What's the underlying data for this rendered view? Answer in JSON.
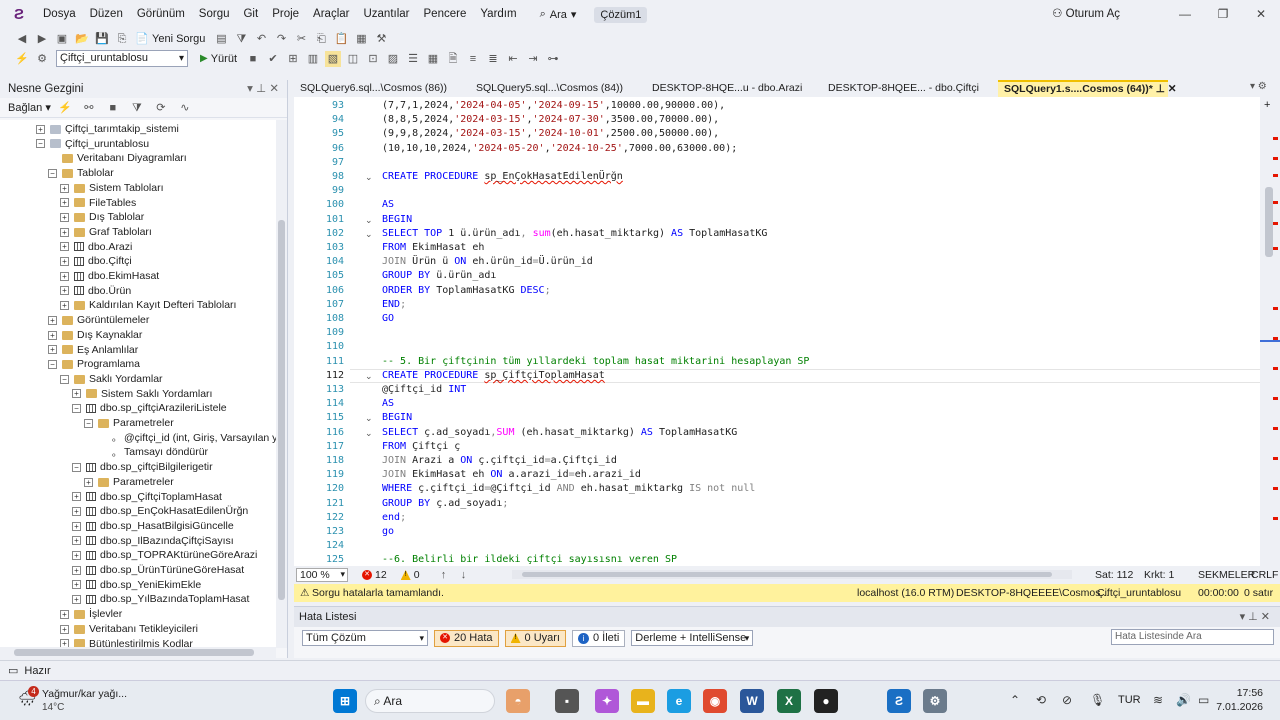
{
  "menu": {
    "items": [
      "Dosya",
      "Düzen",
      "Görünüm",
      "Sorgu",
      "Git",
      "Proje",
      "Araçlar",
      "Uzantılar",
      "Pencere",
      "Yardım"
    ],
    "search": "Ara",
    "solution": "Çözüm1",
    "login": "Oturum Aç"
  },
  "toolbar": {
    "new_query": "Yeni Sorgu",
    "database": "Çiftçi_uruntablosu",
    "execute": "Yürüt"
  },
  "explorer": {
    "title": "Nesne Gezgini",
    "connect": "Bağlan",
    "nodes": [
      {
        "t": "Çiftçi_tarımtakip_sistemi",
        "l": 3,
        "e": "+",
        "i": "db"
      },
      {
        "t": "Çiftçi_uruntablosu",
        "l": 3,
        "e": "-",
        "i": "db"
      },
      {
        "t": "Veritabanı Diyagramları",
        "l": 4,
        "e": "",
        "i": "fold"
      },
      {
        "t": "Tablolar",
        "l": 4,
        "e": "-",
        "i": "fold"
      },
      {
        "t": "Sistem Tabloları",
        "l": 5,
        "e": "+",
        "i": "fold"
      },
      {
        "t": "FileTables",
        "l": 5,
        "e": "+",
        "i": "fold"
      },
      {
        "t": "Dış Tablolar",
        "l": 5,
        "e": "+",
        "i": "fold"
      },
      {
        "t": "Graf Tabloları",
        "l": 5,
        "e": "+",
        "i": "fold"
      },
      {
        "t": "dbo.Arazi",
        "l": 5,
        "e": "+",
        "i": "tbl"
      },
      {
        "t": "dbo.Çiftçi",
        "l": 5,
        "e": "+",
        "i": "tbl"
      },
      {
        "t": "dbo.EkimHasat",
        "l": 5,
        "e": "+",
        "i": "tbl"
      },
      {
        "t": "dbo.Ürün",
        "l": 5,
        "e": "+",
        "i": "tbl"
      },
      {
        "t": "Kaldırılan Kayıt Defteri Tabloları",
        "l": 5,
        "e": "+",
        "i": "fold"
      },
      {
        "t": "Görüntülemeler",
        "l": 4,
        "e": "+",
        "i": "fold"
      },
      {
        "t": "Dış Kaynaklar",
        "l": 4,
        "e": "+",
        "i": "fold"
      },
      {
        "t": "Eş Anlamlılar",
        "l": 4,
        "e": "+",
        "i": "fold"
      },
      {
        "t": "Programlama",
        "l": 4,
        "e": "-",
        "i": "fold"
      },
      {
        "t": "Saklı Yordamlar",
        "l": 5,
        "e": "-",
        "i": "fold"
      },
      {
        "t": "Sistem Saklı Yordamları",
        "l": 6,
        "e": "+",
        "i": "fold"
      },
      {
        "t": "dbo.sp_çiftçiArazileriListele",
        "l": 6,
        "e": "-",
        "i": "tbl"
      },
      {
        "t": "Parametreler",
        "l": 7,
        "e": "-",
        "i": "fold"
      },
      {
        "t": "@çiftçi_id (int, Giriş, Varsayılan yok",
        "l": 8,
        "e": "",
        "i": "par"
      },
      {
        "t": "Tamsayı döndürür",
        "l": 8,
        "e": "",
        "i": "par"
      },
      {
        "t": "dbo.sp_çiftçiBilgilerigetir",
        "l": 6,
        "e": "-",
        "i": "tbl"
      },
      {
        "t": "Parametreler",
        "l": 7,
        "e": "+",
        "i": "fold"
      },
      {
        "t": "dbo.sp_ÇiftçiToplamHasat",
        "l": 6,
        "e": "+",
        "i": "tbl"
      },
      {
        "t": "dbo.sp_EnÇokHasatEdilenÜrğn",
        "l": 6,
        "e": "+",
        "i": "tbl"
      },
      {
        "t": "dbo.sp_HasatBilgisiGüncelle",
        "l": 6,
        "e": "+",
        "i": "tbl"
      },
      {
        "t": "dbo.sp_IlBazındaÇiftçiSayısı",
        "l": 6,
        "e": "+",
        "i": "tbl"
      },
      {
        "t": "dbo.sp_TOPRAKtürüneGöreArazi",
        "l": 6,
        "e": "+",
        "i": "tbl"
      },
      {
        "t": "dbo.sp_ÜrünTürüneGöreHasat",
        "l": 6,
        "e": "+",
        "i": "tbl"
      },
      {
        "t": "dbo.sp_YeniEkimEkle",
        "l": 6,
        "e": "+",
        "i": "tbl"
      },
      {
        "t": "dbo.sp_YılBazındaToplamHasat",
        "l": 6,
        "e": "+",
        "i": "tbl"
      },
      {
        "t": "İşlevler",
        "l": 5,
        "e": "+",
        "i": "fold"
      },
      {
        "t": "Veritabanı Tetikleyicileri",
        "l": 5,
        "e": "+",
        "i": "fold"
      },
      {
        "t": "Bütünleştirilmiş Kodlar",
        "l": 5,
        "e": "+",
        "i": "fold"
      }
    ]
  },
  "tabs": [
    {
      "label": "SQLQuery6.sql...\\Cosmos (86))",
      "active": false
    },
    {
      "label": "SQLQuery5.sql...\\Cosmos (84))",
      "active": false
    },
    {
      "label": "DESKTOP-8HQE...u - dbo.Arazi",
      "active": false
    },
    {
      "label": "DESKTOP-8HQEE... - dbo.Çiftçi",
      "active": false
    },
    {
      "label": "SQLQuery1.s....Cosmos (64))*",
      "active": true
    }
  ],
  "code": [
    {
      "n": "93",
      "f": "",
      "s": [
        [
          "(7,7,1,2024,",
          ""
        ],
        [
          "'2024-04-05'",
          "st"
        ],
        [
          ",",
          ""
        ],
        [
          "'2024-09-15'",
          "st"
        ],
        [
          ",10000.00,90000.00),",
          ""
        ]
      ]
    },
    {
      "n": "94",
      "f": "",
      "s": [
        [
          "(8,8,5,2024,",
          ""
        ],
        [
          "'2024-03-15'",
          "st"
        ],
        [
          ",",
          ""
        ],
        [
          "'2024-07-30'",
          "st"
        ],
        [
          ",3500.00,70000.00),",
          ""
        ]
      ]
    },
    {
      "n": "95",
      "f": "",
      "s": [
        [
          "(9,9,8,2024,",
          ""
        ],
        [
          "'2024-03-15'",
          "st"
        ],
        [
          ",",
          ""
        ],
        [
          "'2024-10-01'",
          "st"
        ],
        [
          ",2500.00,50000.00),",
          ""
        ]
      ]
    },
    {
      "n": "96",
      "f": "",
      "s": [
        [
          "(10,10,10,2024,",
          ""
        ],
        [
          "'2024-05-20'",
          "st"
        ],
        [
          ",",
          ""
        ],
        [
          "'2024-10-25'",
          "st"
        ],
        [
          ",7000.00,63000.00);",
          ""
        ]
      ]
    },
    {
      "n": "97",
      "f": "",
      "s": []
    },
    {
      "n": "98",
      "f": "v",
      "s": [
        [
          "CREATE PROCEDURE",
          "kw"
        ],
        [
          " ",
          ""
        ],
        [
          "sp_EnÇokHasatEdilenÜrğn",
          "sq"
        ]
      ]
    },
    {
      "n": "99",
      "f": "",
      "s": []
    },
    {
      "n": "100",
      "f": "",
      "s": [
        [
          "AS",
          "kw"
        ]
      ]
    },
    {
      "n": "101",
      "f": "v",
      "s": [
        [
          "BEGIN",
          "kw"
        ]
      ]
    },
    {
      "n": "102",
      "f": "v",
      "s": [
        [
          "SELECT TOP",
          "kw"
        ],
        [
          " 1 ü.ürün_adı",
          ""
        ],
        [
          ",",
          "gr"
        ],
        [
          " ",
          ""
        ],
        [
          "sum",
          "fn"
        ],
        [
          "(eh.hasat_miktarkg) ",
          ""
        ],
        [
          "AS",
          "kw"
        ],
        [
          " ToplamHasatKG",
          ""
        ]
      ]
    },
    {
      "n": "103",
      "f": "",
      "s": [
        [
          "FROM",
          "kw"
        ],
        [
          " EkimHasat eh",
          ""
        ]
      ]
    },
    {
      "n": "104",
      "f": "",
      "s": [
        [
          "JOIN",
          "gr"
        ],
        [
          " Ürün ü ",
          ""
        ],
        [
          "ON",
          "kw"
        ],
        [
          " eh.ürün_id",
          ""
        ],
        [
          "=",
          "gr"
        ],
        [
          "Ü.ürün_id",
          ""
        ]
      ]
    },
    {
      "n": "105",
      "f": "",
      "s": [
        [
          "GROUP BY",
          "kw"
        ],
        [
          " ü.ürün_adı",
          ""
        ]
      ]
    },
    {
      "n": "106",
      "f": "",
      "s": [
        [
          "ORDER BY",
          "kw"
        ],
        [
          " ToplamHasatKG ",
          ""
        ],
        [
          "DESC",
          "kw"
        ],
        [
          ";",
          "gr"
        ]
      ]
    },
    {
      "n": "107",
      "f": "",
      "s": [
        [
          "END",
          "kw"
        ],
        [
          ";",
          "gr"
        ]
      ]
    },
    {
      "n": "108",
      "f": "",
      "s": [
        [
          "GO",
          "kw"
        ]
      ]
    },
    {
      "n": "109",
      "f": "",
      "s": []
    },
    {
      "n": "110",
      "f": "",
      "s": []
    },
    {
      "n": "111",
      "f": "",
      "s": [
        [
          "-- 5. Bir çiftçinin tüm yıllardeki toplam hasat miktarini hesaplayan SP",
          "cm"
        ]
      ]
    },
    {
      "n": "112",
      "f": "v",
      "cur": true,
      "s": [
        [
          "CREATE PROCEDURE",
          "kw"
        ],
        [
          " ",
          ""
        ],
        [
          "sp_ÇiftçiToplamHasat",
          "sq"
        ]
      ]
    },
    {
      "n": "113",
      "f": "",
      "s": [
        [
          "@Çiftçi_id ",
          ""
        ],
        [
          "INT",
          "kw"
        ]
      ]
    },
    {
      "n": "114",
      "f": "",
      "s": [
        [
          "AS",
          "kw"
        ]
      ]
    },
    {
      "n": "115",
      "f": "v",
      "s": [
        [
          "BEGIN",
          "kw"
        ]
      ]
    },
    {
      "n": "116",
      "f": "v",
      "s": [
        [
          "SELECT",
          "kw"
        ],
        [
          " ç.ad_soyadı",
          ""
        ],
        [
          ",",
          "gr"
        ],
        [
          "SUM",
          "fn"
        ],
        [
          " (eh.hasat_miktarkg) ",
          ""
        ],
        [
          "AS",
          "kw"
        ],
        [
          " ToplamHasatKG",
          ""
        ]
      ]
    },
    {
      "n": "117",
      "f": "",
      "s": [
        [
          "FROM",
          "kw"
        ],
        [
          " Çiftçi ç",
          ""
        ]
      ]
    },
    {
      "n": "118",
      "f": "",
      "s": [
        [
          "JOIN",
          "gr"
        ],
        [
          " Arazi a ",
          ""
        ],
        [
          "ON",
          "kw"
        ],
        [
          " ç.çiftçi_id",
          ""
        ],
        [
          "=",
          "gr"
        ],
        [
          "a.Çiftçi_id",
          ""
        ]
      ]
    },
    {
      "n": "119",
      "f": "",
      "s": [
        [
          "JOIN",
          "gr"
        ],
        [
          " EkimHasat eh ",
          ""
        ],
        [
          "ON",
          "kw"
        ],
        [
          " a.arazi_id",
          ""
        ],
        [
          "=",
          "gr"
        ],
        [
          "eh.arazi_id",
          ""
        ]
      ]
    },
    {
      "n": "120",
      "f": "",
      "s": [
        [
          "WHERE",
          "kw"
        ],
        [
          " ç.çiftçi_id",
          ""
        ],
        [
          "=",
          "gr"
        ],
        [
          "@Çiftçi_id ",
          ""
        ],
        [
          "AND",
          "gr"
        ],
        [
          " eh.hasat_miktarkg ",
          ""
        ],
        [
          "IS not null",
          "gr"
        ]
      ]
    },
    {
      "n": "121",
      "f": "",
      "s": [
        [
          "GROUP BY",
          "kw"
        ],
        [
          " ç.ad_soyadı",
          ""
        ],
        [
          ";",
          "gr"
        ]
      ]
    },
    {
      "n": "122",
      "f": "",
      "s": [
        [
          "end",
          "kw"
        ],
        [
          ";",
          "gr"
        ]
      ]
    },
    {
      "n": "123",
      "f": "",
      "s": [
        [
          "go",
          "kw"
        ]
      ]
    },
    {
      "n": "124",
      "f": "",
      "s": []
    },
    {
      "n": "125",
      "f": "",
      "s": [
        [
          "--6. Belirli bir ildeki çiftçi sayısısnı veren SP",
          "cm"
        ]
      ]
    }
  ],
  "editor_status": {
    "zoom": "100 %",
    "errors": "12",
    "warnings": "0",
    "line": "Sat: 112",
    "col": "Krkt: 1",
    "mode": "SEKMELER",
    "eol": "CRLF"
  },
  "query_status": {
    "message": "Sorgu hatalarla tamamlandı.",
    "server": "localhost (16.0 RTM)",
    "user": "DESKTOP-8HQEEEE\\Cosmos...",
    "db": "Çiftçi_uruntablosu",
    "time": "00:00:00",
    "rows": "0 satır"
  },
  "error_list": {
    "title": "Hata Listesi",
    "scope": "Tüm Çözüm",
    "errors": "20 Hata",
    "warnings": "0 Uyarı",
    "messages": "0 İleti",
    "build": "Derleme + IntelliSense",
    "search": "Hata Listesinde Ara"
  },
  "app_status": "Hazır",
  "taskbar": {
    "weather": "Yağmur/kar yağı...",
    "temp": "14°C",
    "weather_badge": "4",
    "search": "Ara",
    "lang": "TUR",
    "time": "17:56",
    "date": "7.01.2026"
  }
}
